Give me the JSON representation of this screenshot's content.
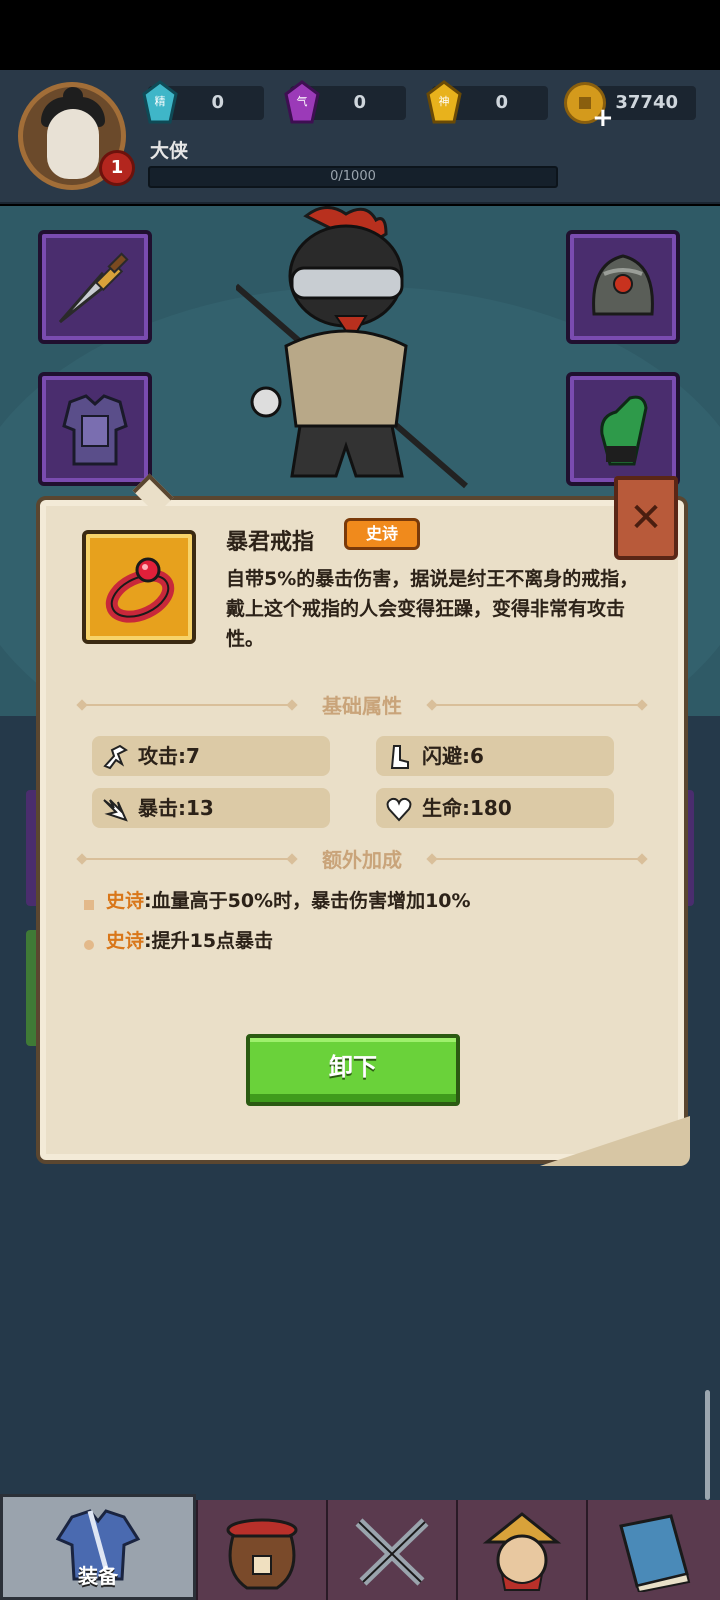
{
  "player": {
    "level": "1",
    "title": "大侠",
    "xp_text": "0/1000"
  },
  "resources": [
    {
      "icon": "jing-gem-icon",
      "glyph": "精",
      "value": "0",
      "color": "#3fb6c8"
    },
    {
      "icon": "qi-gem-icon",
      "glyph": "气",
      "value": "0",
      "color": "#9b3ab8"
    },
    {
      "icon": "shen-gem-icon",
      "glyph": "神",
      "value": "0",
      "color": "#e8b21c"
    }
  ],
  "gold": {
    "value": "37740"
  },
  "equipment_slots": [
    "dagger-icon",
    "helmet-icon",
    "armor-icon",
    "glove-icon"
  ],
  "dialog": {
    "item_name": "暴君戒指",
    "rarity": "史诗",
    "description": "自带5%的暴击伤害，据说是纣王不离身的戒指，戴上这个戒指的人会变得狂躁，变得非常有攻击性。",
    "base_section_title": "基础属性",
    "stats": [
      {
        "icon": "attack-icon",
        "text": "攻击:7"
      },
      {
        "icon": "dodge-icon",
        "text": "闪避:6"
      },
      {
        "icon": "crit-icon",
        "text": "暴击:13"
      },
      {
        "icon": "heart-icon",
        "text": "生命:180"
      }
    ],
    "bonus_section_title": "额外加成",
    "bonuses": [
      {
        "tag": "史诗",
        "text": ":血量高于50%时，暴击伤害增加10%"
      },
      {
        "tag": "史诗",
        "text": ":提升15点暴击"
      }
    ],
    "close_glyph": "✕",
    "unequip_label": "卸下"
  },
  "nav": {
    "tabs": [
      {
        "label": "装备",
        "icon": "robe-icon",
        "active": true
      },
      {
        "label": "",
        "icon": "wine-jar-icon",
        "active": false
      },
      {
        "label": "",
        "icon": "crossed-swords-icon",
        "active": false
      },
      {
        "label": "",
        "icon": "warrior-face-icon",
        "active": false
      },
      {
        "label": "",
        "icon": "book-icon",
        "active": false
      }
    ]
  },
  "colors": {
    "rarity_epic": "#f08a1c",
    "button_green": "#6ad23a",
    "slot_purple": "#4a2d6e",
    "paper": "#eadfc8"
  }
}
